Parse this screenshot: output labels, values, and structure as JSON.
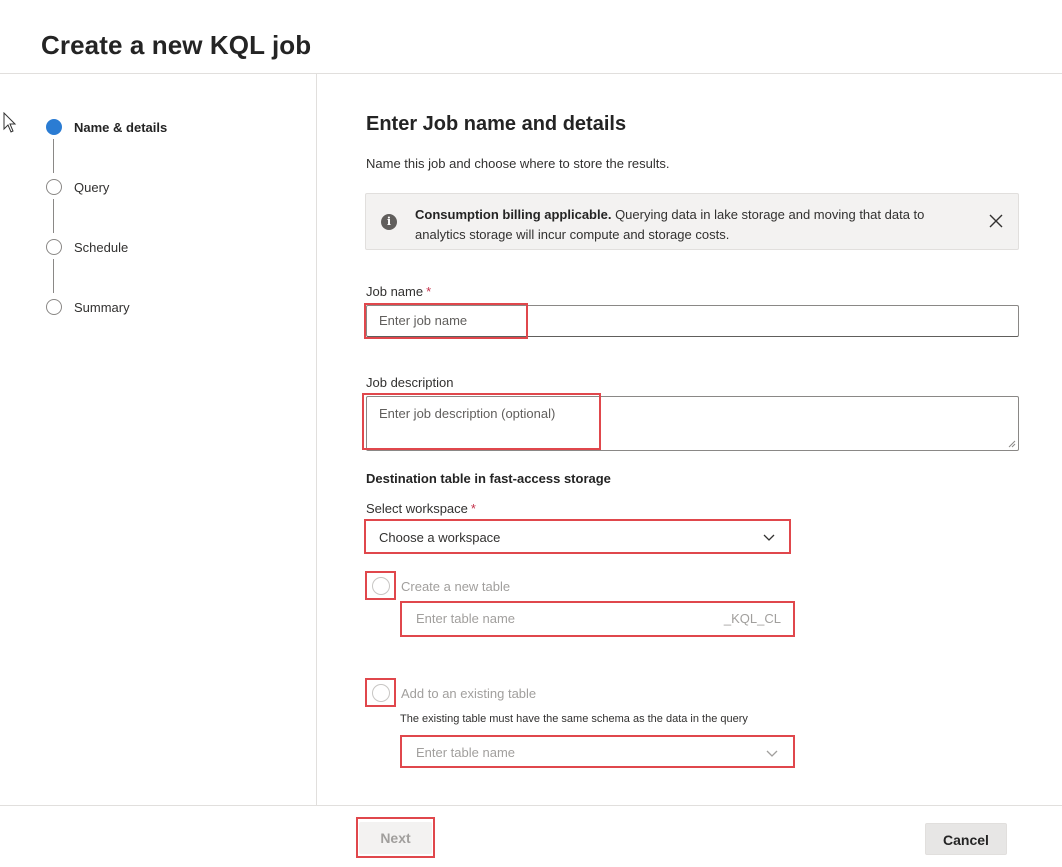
{
  "window": {
    "title": "Create a new KQL job"
  },
  "steps": [
    {
      "label": "Name & details",
      "active": true
    },
    {
      "label": "Query",
      "active": false
    },
    {
      "label": "Schedule",
      "active": false
    },
    {
      "label": "Summary",
      "active": false
    }
  ],
  "main": {
    "heading": "Enter Job name and details",
    "subheading": "Name this job and choose where to store the results.",
    "banner": {
      "bold": "Consumption billing applicable.",
      "text": " Querying data in lake storage and moving that data to analytics storage will incur compute and storage costs.",
      "icon": "info-icon",
      "close_icon": "close-icon"
    },
    "job_name": {
      "label": "Job name",
      "required": "*",
      "placeholder": "Enter job name"
    },
    "job_description": {
      "label": "Job description",
      "placeholder": "Enter job description (optional)"
    },
    "destination_heading": "Destination table in fast-access storage",
    "workspace": {
      "label": "Select workspace",
      "required": "*",
      "placeholder": "Choose a workspace"
    },
    "new_table": {
      "label": "Create a new table",
      "placeholder": "Enter table name",
      "suffix": "_KQL_CL"
    },
    "existing_table": {
      "label": "Add to an existing table",
      "hint": "The existing table must have the same schema as the data in the query",
      "placeholder": "Enter table name"
    }
  },
  "footer": {
    "next_label": "Next",
    "cancel_label": "Cancel"
  },
  "colors": {
    "accent": "#2b7cd3",
    "highlight": "#e0474c",
    "required": "#c4314b"
  }
}
